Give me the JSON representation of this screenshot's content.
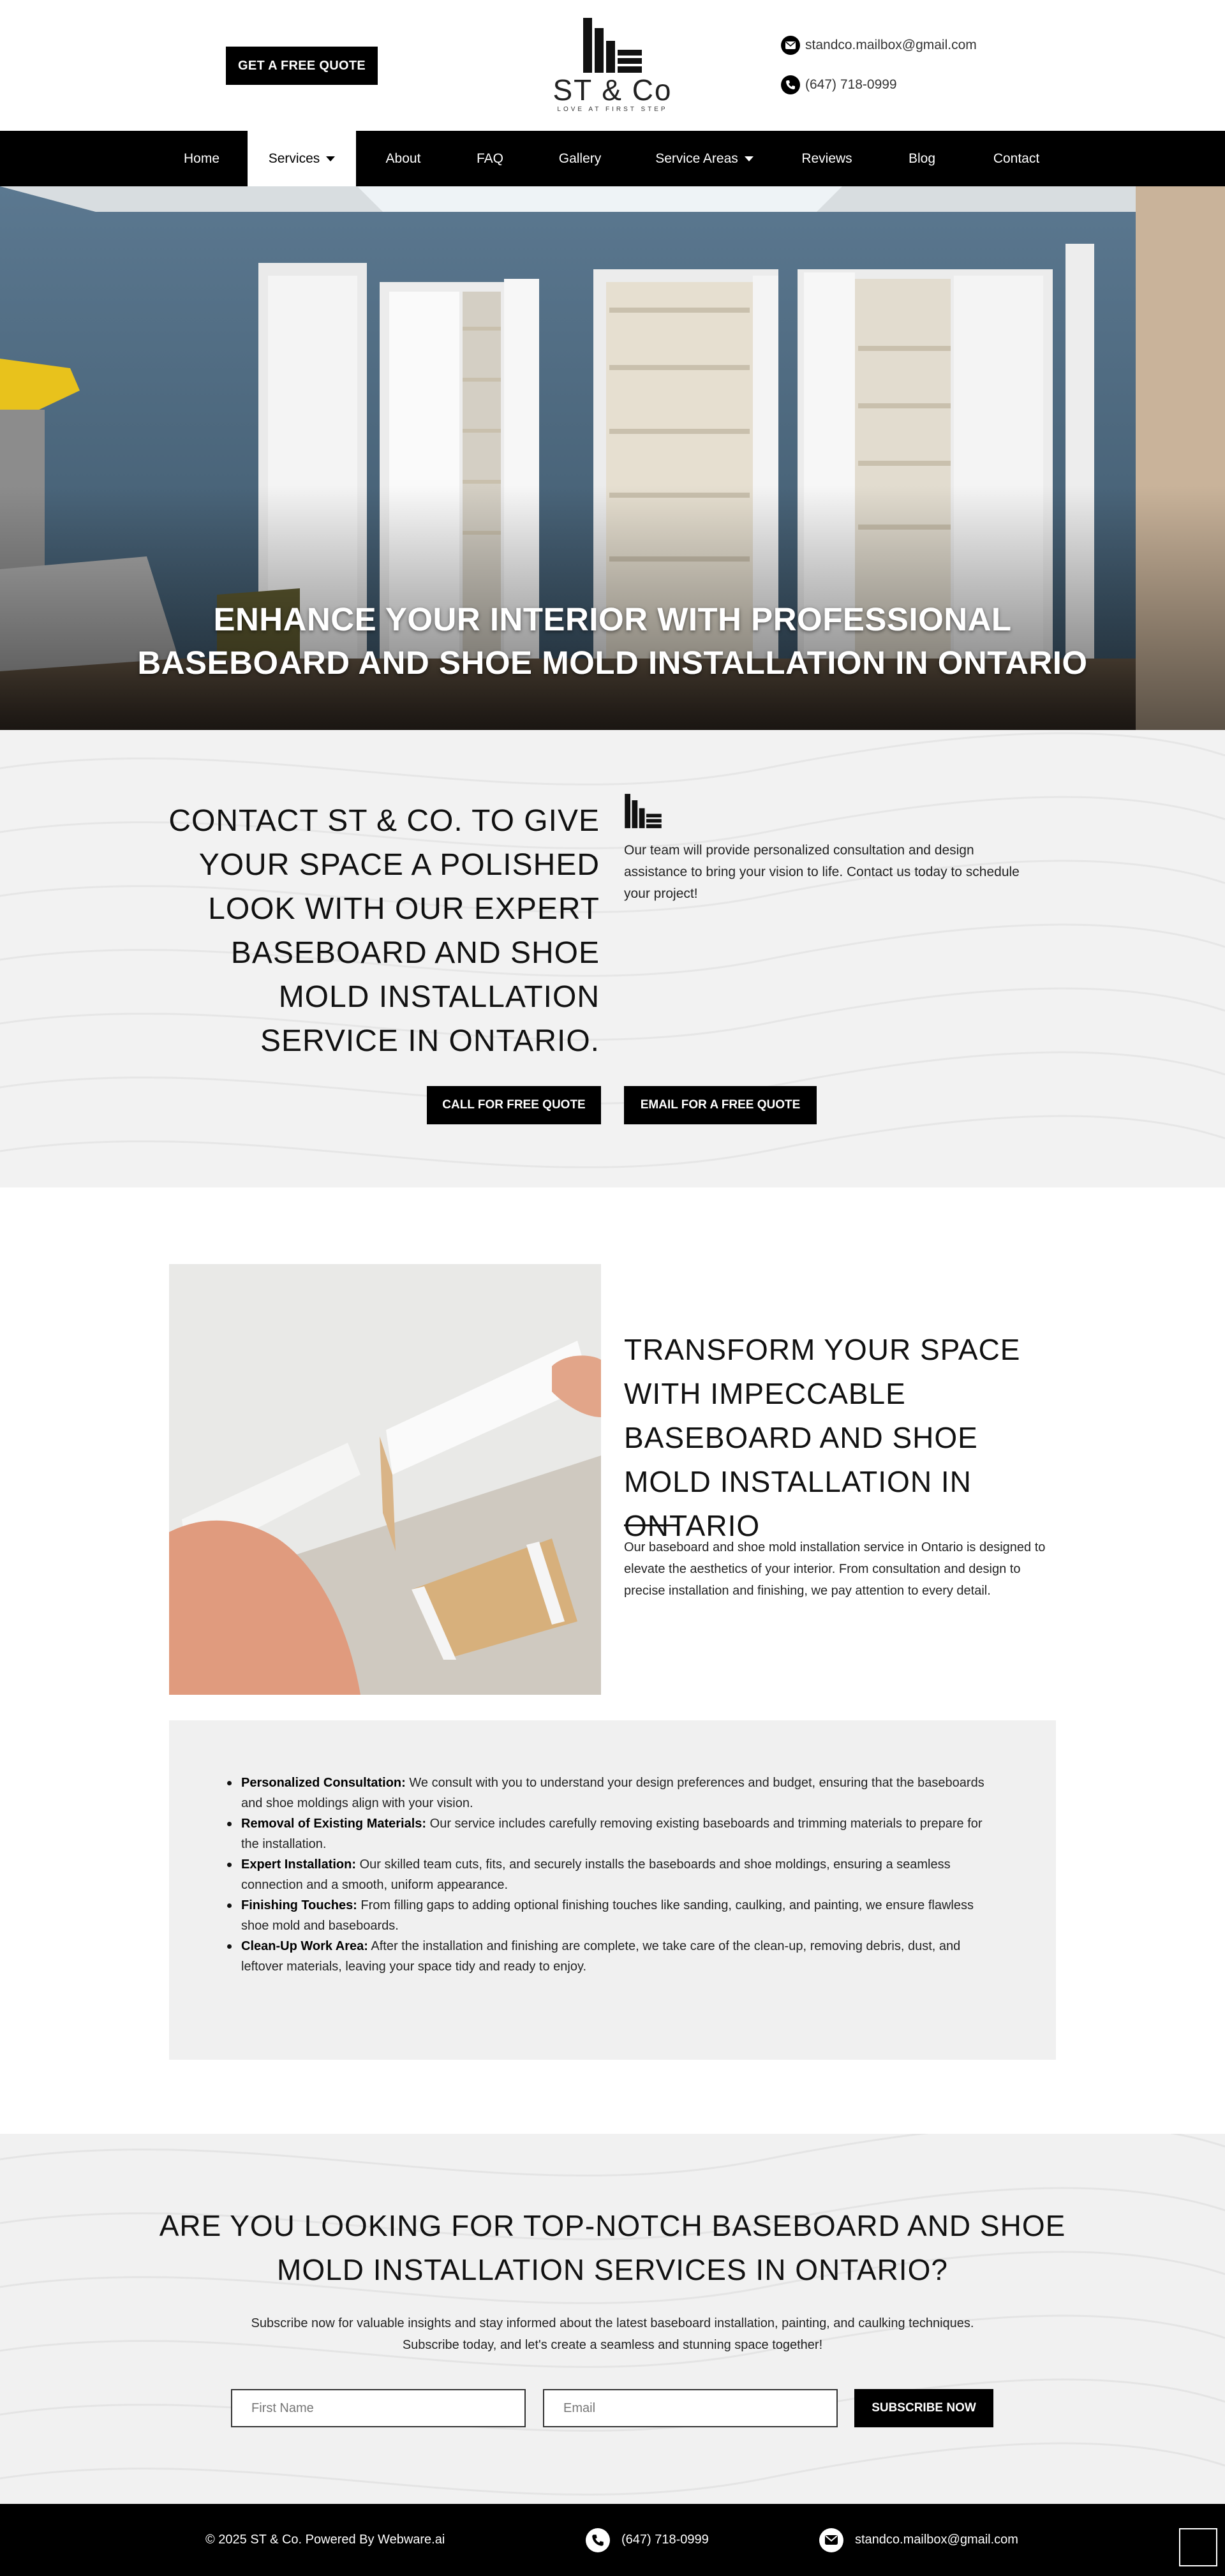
{
  "header": {
    "quote_button": "GET A FREE QUOTE",
    "logo_name": "ST & Co",
    "logo_tagline": "LOVE AT FIRST STEP",
    "email": "standco.mailbox@gmail.com",
    "phone": "(647) 718-0999"
  },
  "nav": {
    "items": [
      "Home",
      "Services",
      "About",
      "FAQ",
      "Gallery",
      "Service Areas",
      "Reviews",
      "Blog",
      "Contact"
    ],
    "active": "Services"
  },
  "hero": {
    "title_line1": "ENHANCE YOUR INTERIOR WITH PROFESSIONAL",
    "title_line2": "BASEBOARD AND SHOE MOLD INSTALLATION IN ONTARIO"
  },
  "contact_section": {
    "heading": "CONTACT ST & CO. TO GIVE YOUR SPACE A POLISHED LOOK WITH OUR EXPERT BASEBOARD AND SHOE MOLD INSTALLATION SERVICE IN ONTARIO.",
    "text": "Our team will provide personalized consultation and design assistance to bring your vision to life. Contact us today to schedule your project!",
    "call_button": "CALL FOR FREE QUOTE",
    "email_button": "EMAIL FOR A FREE QUOTE"
  },
  "transform": {
    "heading": "TRANSFORM YOUR SPACE WITH IMPECCABLE BASEBOARD AND SHOE MOLD INSTALLATION IN ONTARIO",
    "text": "Our baseboard and shoe mold installation service in Ontario is designed to elevate the aesthetics of your interior. From consultation and design to precise installation and finishing, we pay attention to every detail.",
    "features": [
      {
        "title": "Personalized Consultation:",
        "text": " We consult with you to understand your design preferences and budget, ensuring that the baseboards and shoe moldings align with your vision."
      },
      {
        "title": "Removal of Existing Materials:",
        "text": " Our service includes carefully removing existing baseboards and trimming materials to prepare for the installation."
      },
      {
        "title": "Expert Installation:",
        "text": " Our skilled team cuts, fits, and securely installs the baseboards and shoe moldings, ensuring a seamless connection and a smooth, uniform appearance."
      },
      {
        "title": "Finishing Touches:",
        "text": " From filling gaps to adding optional finishing touches like sanding, caulking, and painting, we ensure flawless shoe mold and baseboards."
      },
      {
        "title": "Clean-Up Work Area:",
        "text": " After the installation and finishing are complete, we take care of the clean-up, removing debris, dust, and leftover materials, leaving your space tidy and ready to enjoy."
      }
    ]
  },
  "subscribe": {
    "heading_line1": "ARE YOU LOOKING FOR TOP-NOTCH BASEBOARD AND SHOE",
    "heading_line2": "MOLD INSTALLATION SERVICES IN ONTARIO?",
    "text_line1": "Subscribe now for valuable insights and stay informed about the latest baseboard installation, painting, and caulking techniques.",
    "text_line2": "Subscribe today, and let's create a seamless and stunning space together!",
    "first_name_placeholder": "First Name",
    "email_placeholder": "Email",
    "button": "SUBSCRIBE NOW"
  },
  "footer": {
    "copyright": "© 2025 ST & Co. Powered By Webware.ai",
    "phone": "(647) 718-0999",
    "email": "standco.mailbox@gmail.com"
  }
}
